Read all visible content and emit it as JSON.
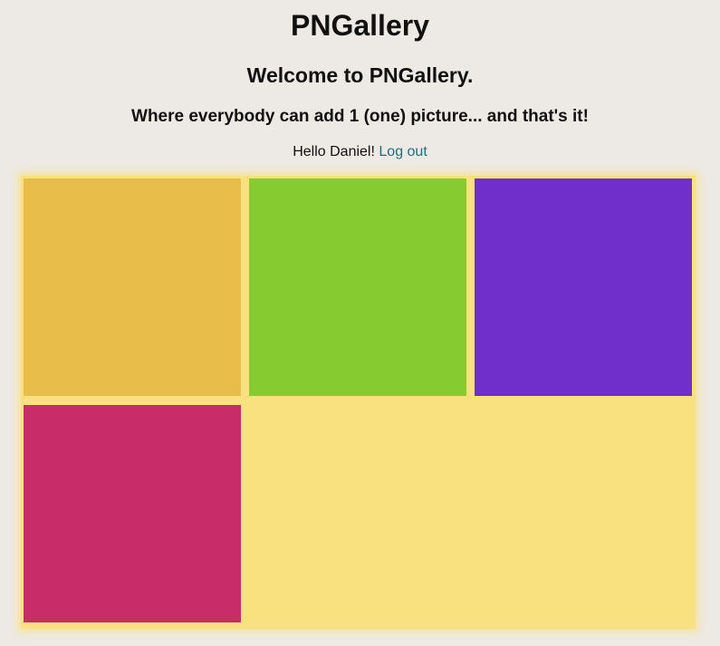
{
  "header": {
    "site_title": "PNGallery",
    "welcome": "Welcome to PNGallery.",
    "tagline": "Where everybody can add 1 (one) picture... and that's it!"
  },
  "user_bar": {
    "greeting": "Hello Daniel!",
    "logout_label": "Log out"
  },
  "gallery": {
    "background_color": "#fae17f",
    "pictures": [
      {
        "color": "#e9bd4a"
      },
      {
        "color": "#86cb2f"
      },
      {
        "color": "#702ecb"
      },
      {
        "color": "#c82d6a"
      }
    ]
  }
}
